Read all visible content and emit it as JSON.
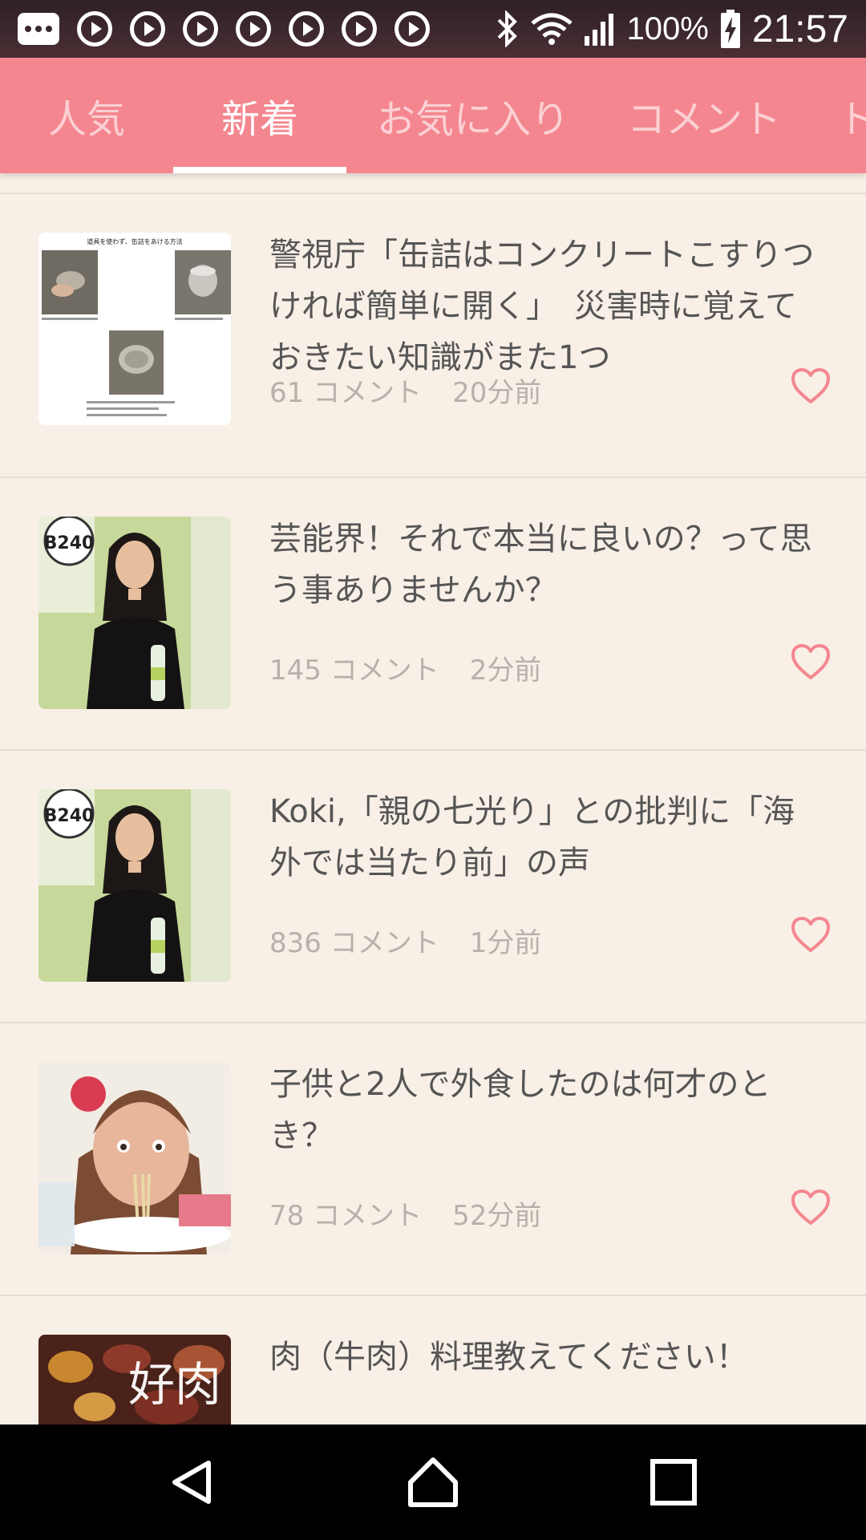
{
  "status_bar": {
    "battery": "100%",
    "time": "21:57"
  },
  "tabs": [
    {
      "label": "人気",
      "active": false
    },
    {
      "label": "新着",
      "active": true
    },
    {
      "label": "お気に入り",
      "active": false
    },
    {
      "label": "コメント",
      "active": false
    },
    {
      "label": "ト",
      "active": false
    }
  ],
  "articles": [
    {
      "title": "警視庁「缶詰はコンクリートこすりつければ簡単に開く」　災害時に覚えておきたい知識がまた1つ",
      "comments": "61 コメント",
      "time": "20分前",
      "thumb_caption": "道具を使わず、缶詰をあける方法"
    },
    {
      "title": "芸能界！それで本当に良いの？って思う事ありませんか？",
      "comments": "145 コメント",
      "time": "2分前"
    },
    {
      "title": "Koki,「親の七光り」との批判に「海外では当たり前」の声",
      "comments": "836 コメント",
      "time": "1分前"
    },
    {
      "title": "子供と2人で外食したのは何才のとき？",
      "comments": "78 コメント",
      "time": "52分前"
    },
    {
      "title": "肉（牛肉）料理教えてください！",
      "thumb_text": "好肉"
    }
  ],
  "colors": {
    "tab_bar": "#f4868f",
    "background": "#f8efe6",
    "heart": "#f4868f"
  }
}
